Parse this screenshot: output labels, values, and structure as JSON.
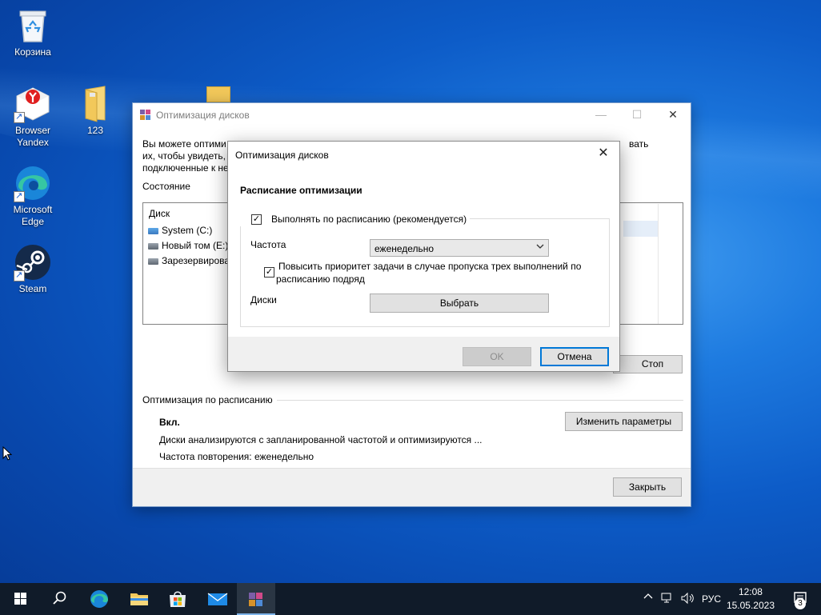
{
  "desktop": {
    "icons": [
      {
        "label": "Корзина"
      },
      {
        "label": "Browser Yandex"
      },
      {
        "label": "123"
      },
      {
        "label": "Microsoft Edge"
      },
      {
        "label": "Steam"
      }
    ]
  },
  "main_window": {
    "title": "Оптимизация дисков",
    "controls": {
      "minimize": "—",
      "maximize": "☐",
      "close": "✕"
    },
    "description_line1": "Вы можете оптими",
    "description_line1_end": "вать",
    "description_line2": "их, чтобы увидеть, т",
    "description_line3": "подключенные к не",
    "status_section": "Состояние",
    "list": {
      "column_disk": "Диск",
      "rows": [
        {
          "name": "System (C:)"
        },
        {
          "name": "Новый том (E:)"
        },
        {
          "name": "Зарезервирова"
        }
      ]
    },
    "stop_button": "Стоп",
    "schedule_section": "Оптимизация по расписанию",
    "schedule_state": "Вкл.",
    "schedule_desc": "Диски анализируются с запланированной частотой и оптимизируются ...",
    "schedule_freq": "Частота повторения: еженедельно",
    "change_params_button": "Изменить параметры",
    "close_button": "Закрыть"
  },
  "dialog": {
    "title": "Оптимизация дисков",
    "close_icon": "✕",
    "heading": "Расписание оптимизации",
    "run_on_schedule": {
      "label": "Выполнять по расписанию (рекомендуется)",
      "checked": true
    },
    "frequency_label": "Частота",
    "frequency_value": "еженедельно",
    "raise_priority": {
      "label_line1": "Повысить приоритет задачи в случае пропуска трех выполнений по",
      "label_line2": "расписанию подряд",
      "checked": true
    },
    "disks_label": "Диски",
    "choose_button": "Выбрать",
    "ok_button": "OK",
    "cancel_button": "Отмена"
  },
  "taskbar": {
    "tray_lang": "РУС",
    "time": "12:08",
    "date": "15.05.2023",
    "notification_count": "3"
  },
  "colors": {
    "accent": "#0078d7",
    "taskbar": "#101b29"
  }
}
